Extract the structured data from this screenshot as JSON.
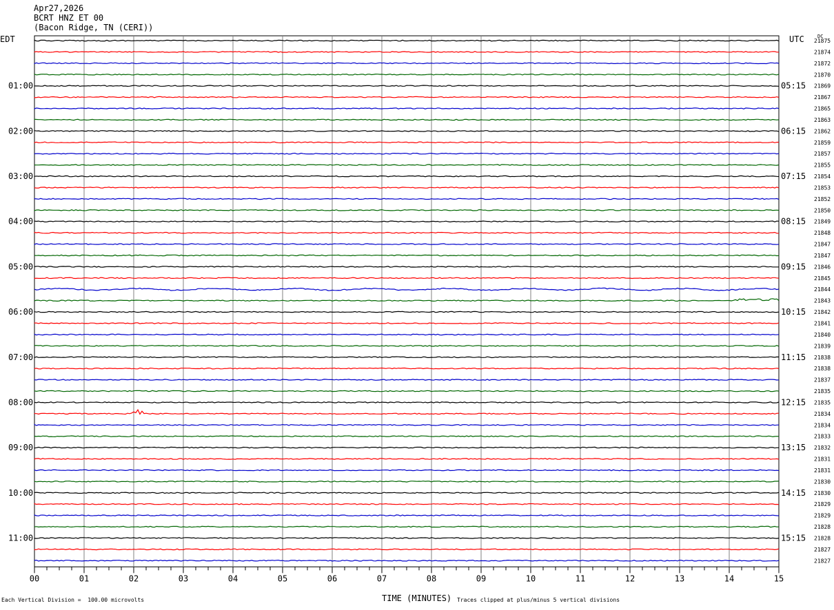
{
  "header": {
    "date": "Apr27,2026",
    "station": "BCRT HNZ ET 00",
    "location": "(Bacon Ridge, TN (CERI))"
  },
  "labels": {
    "left_timezone": "EDT",
    "right_timezone": "UTC",
    "dc": "DC"
  },
  "footer": {
    "scale": "Each Vertical Division =  100.00 microvolts",
    "clip": "Traces clipped at plus/minus 5 vertical divisions"
  },
  "colors": {
    "trace_cycle": [
      "#000000",
      "#ff0000",
      "#0000cc",
      "#006600"
    ],
    "grid": "#808080"
  },
  "chart_data": {
    "type": "line",
    "title": "",
    "xlabel": "TIME (MINUTES)",
    "ylabel": "",
    "xlim": [
      0,
      15
    ],
    "x_ticks": [
      "00",
      "01",
      "02",
      "03",
      "04",
      "05",
      "06",
      "07",
      "08",
      "09",
      "10",
      "11",
      "12",
      "13",
      "14",
      "15"
    ],
    "left_hour_labels": [
      "01:00",
      "02:00",
      "03:00",
      "04:00",
      "05:00",
      "06:00",
      "07:00",
      "08:00",
      "09:00",
      "10:00",
      "11:00"
    ],
    "right_hour_labels": [
      "05:15",
      "06:15",
      "07:15",
      "08:15",
      "09:15",
      "10:15",
      "11:15",
      "12:15",
      "13:15",
      "14:15",
      "15:15"
    ],
    "dc_offsets": [
      21875,
      21874,
      21872,
      21870,
      21869,
      21867,
      21865,
      21863,
      21862,
      21859,
      21857,
      21855,
      21854,
      21853,
      21852,
      21850,
      21849,
      21848,
      21847,
      21847,
      21846,
      21845,
      21844,
      21843,
      21842,
      21841,
      21840,
      21839,
      21838,
      21838,
      21837,
      21835,
      21835,
      21834,
      21834,
      21833,
      21832,
      21831,
      21831,
      21830,
      21830,
      21829,
      21829,
      21828,
      21828,
      21827,
      21827
    ],
    "events": [
      {
        "trace": 33,
        "minute": 2.1,
        "description": "small transient burst"
      },
      {
        "trace": 23,
        "minute": 14.1,
        "description": "offset / disturbance"
      }
    ],
    "grid": true,
    "legend": "none"
  }
}
